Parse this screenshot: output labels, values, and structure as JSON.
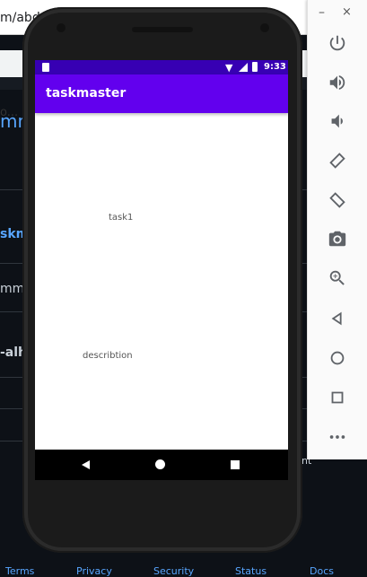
{
  "background": {
    "url_fragment": "m/abd",
    "strip_fragment": "o...",
    "fragments": [
      {
        "text": "mm",
        "style": "big"
      },
      {
        "text": "skm",
        "style": "blue"
      },
      {
        "text": "mmi",
        "style": "white"
      },
      {
        "text": "-alh",
        "style": "bold"
      },
      {
        "text": "nt",
        "style": "white"
      }
    ],
    "footer_links": [
      "Terms",
      "Privacy",
      "Security",
      "Status",
      "Docs"
    ]
  },
  "phone": {
    "status_time": "9:33",
    "app_title": "taskmaster",
    "task_label": "task1",
    "description_label": "describtion"
  },
  "emulator_toolbar": {
    "minimize": "–",
    "close": "×",
    "buttons": [
      "power-icon",
      "volume-up-icon",
      "volume-down-icon",
      "rotate-left-icon",
      "rotate-right-icon",
      "camera-icon",
      "zoom-icon",
      "back-icon",
      "home-icon",
      "overview-icon",
      "more-icon"
    ]
  },
  "colors": {
    "status_bar": "#3700b3",
    "app_bar": "#6200ee",
    "github_bg": "#0d1117",
    "link_blue": "#58a6ff"
  }
}
